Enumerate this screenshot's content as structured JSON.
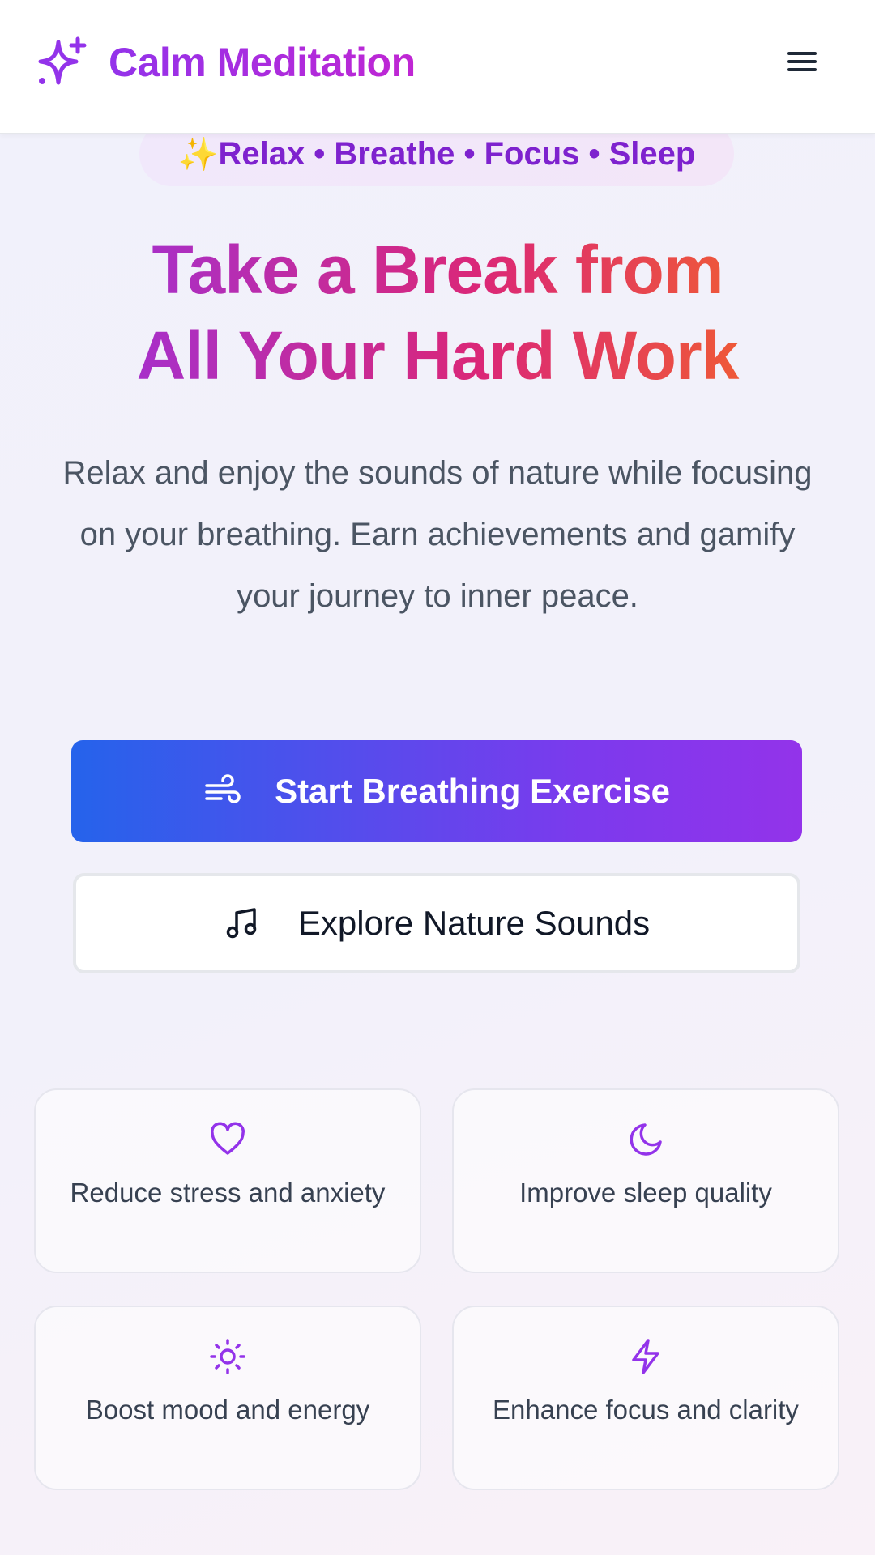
{
  "header": {
    "brand": "Calm Meditation",
    "logo_icon": "sparkles-icon",
    "menu_icon": "hamburger-menu-icon"
  },
  "tagline_pill": {
    "emoji": "✨",
    "text": "Relax • Breathe • Focus • Sleep"
  },
  "hero": {
    "title_line1": "Take a Break from",
    "title_line2": "All Your Hard Work",
    "subtitle": "Relax and enjoy the sounds of nature while focusing on your breathing. Earn achievements and gamify your journey to inner peace."
  },
  "actions": {
    "primary": {
      "label": "Start Breathing Exercise",
      "icon": "wind-icon"
    },
    "secondary": {
      "label": "Explore Nature Sounds",
      "icon": "music-note-icon"
    }
  },
  "benefits": [
    {
      "label": "Reduce stress and anxiety",
      "icon": "heart-icon"
    },
    {
      "label": "Improve sleep quality",
      "icon": "moon-icon"
    },
    {
      "label": "Boost mood and energy",
      "icon": "sun-icon"
    },
    {
      "label": "Enhance focus and clarity",
      "icon": "lightning-icon"
    }
  ],
  "colors": {
    "brand_purple": "#9333ea",
    "primary_gradient_start": "#2563eb",
    "primary_gradient_end": "#9333ea",
    "title_gradient_end": "#f97316",
    "icon_purple": "#9333ea"
  }
}
